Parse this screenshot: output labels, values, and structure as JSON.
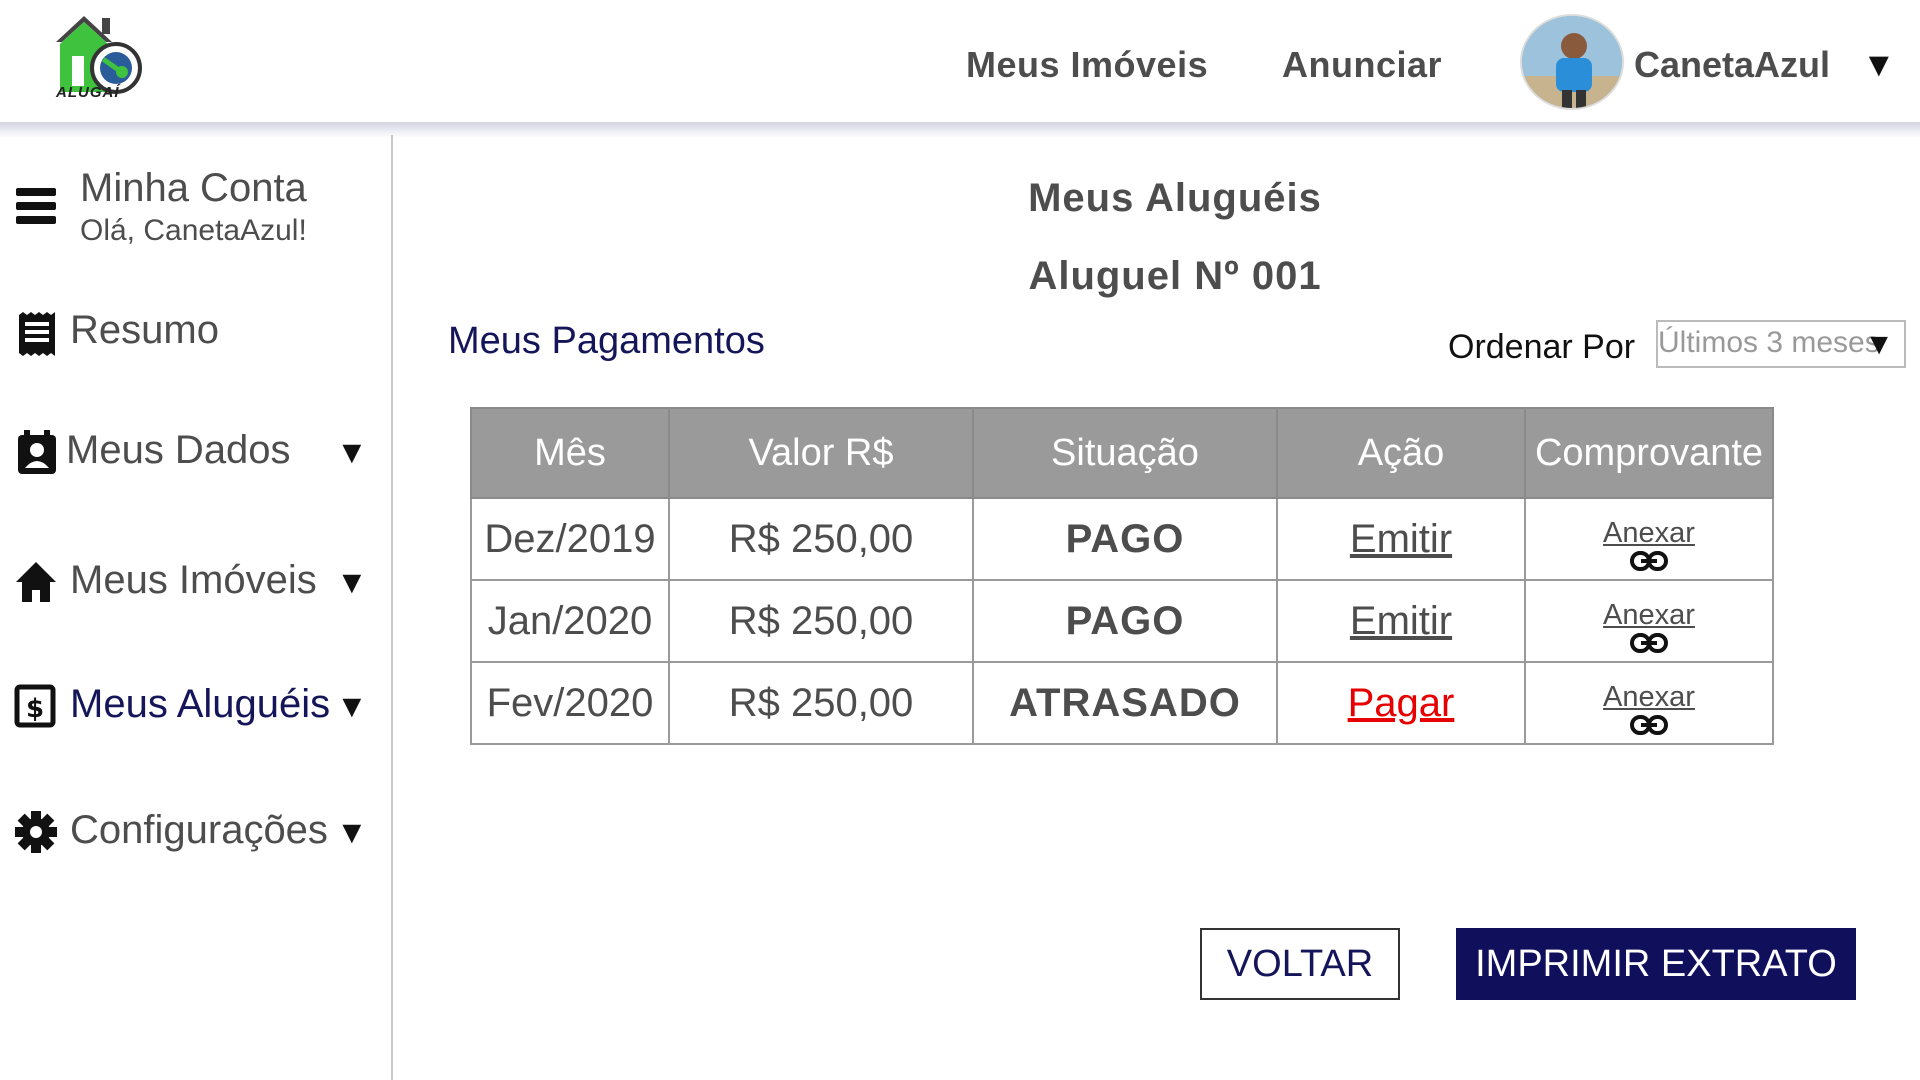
{
  "header": {
    "logo_text": "ALUGAÍ",
    "nav": [
      "Meus Imóveis",
      "Anunciar"
    ],
    "user_name": "CanetaAzul",
    "user_caret": "▼"
  },
  "sidebar": {
    "account_title": "Minha Conta",
    "greeting": "Olá, CanetaAzul!",
    "items": [
      {
        "label": "Resumo",
        "icon": "receipt-icon",
        "caret": ""
      },
      {
        "label": "Meus Dados",
        "icon": "contact-card-icon",
        "caret": "▼"
      },
      {
        "label": "Meus Imóveis",
        "icon": "home-icon",
        "caret": "▼"
      },
      {
        "label": "Meus Aluguéis",
        "icon": "dollar-box-icon",
        "caret": "▼",
        "active": true
      },
      {
        "label": "Configurações",
        "icon": "gear-icon",
        "caret": "▼"
      }
    ]
  },
  "main": {
    "title": "Meus Aluguéis",
    "subtitle": "Aluguel Nº 001",
    "payments_label": "Meus Pagamentos",
    "order_label": "Ordenar Por",
    "order_value": "Últimos 3 meses",
    "order_caret": "▼",
    "table": {
      "headers": [
        "Mês",
        "Valor R$",
        "Situação",
        "Ação",
        "Comprovante"
      ],
      "rows": [
        {
          "month": "Dez/2019",
          "value": "R$ 250,00",
          "status": "PAGO",
          "action": "Emitir",
          "receipt": "Anexar"
        },
        {
          "month": "Jan/2020",
          "value": "R$ 250,00",
          "status": "PAGO",
          "action": "Emitir",
          "receipt": "Anexar"
        },
        {
          "month": "Fev/2020",
          "value": "R$ 250,00",
          "status": "ATRASADO",
          "action": "Pagar",
          "receipt": "Anexar"
        }
      ]
    },
    "back_button": "VOLTAR",
    "print_button": "IMPRIMIR EXTRATO"
  },
  "colors": {
    "primary": "#0f0f5c",
    "paid": "#0c7a0c",
    "late": "#e60000",
    "table_header": "#9a9a9a",
    "logo_green": "#3fc33f"
  }
}
